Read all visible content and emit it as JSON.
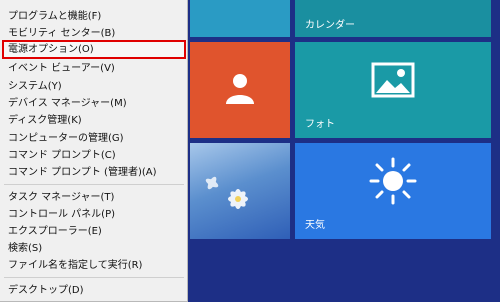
{
  "menu": {
    "group1": [
      {
        "label": "プログラムと機能(F)"
      },
      {
        "label": "モビリティ センター(B)"
      },
      {
        "label": "電源オプション(O)"
      },
      {
        "label": "イベント ビューアー(V)"
      },
      {
        "label": "システム(Y)"
      },
      {
        "label": "デバイス マネージャー(M)"
      },
      {
        "label": "ディスク管理(K)"
      },
      {
        "label": "コンピューターの管理(G)"
      },
      {
        "label": "コマンド プロンプト(C)"
      },
      {
        "label": "コマンド プロンプト (管理者)(A)"
      }
    ],
    "group2": [
      {
        "label": "タスク マネージャー(T)"
      },
      {
        "label": "コントロール パネル(P)"
      },
      {
        "label": "エクスプローラー(E)"
      },
      {
        "label": "検索(S)"
      },
      {
        "label": "ファイル名を指定して実行(R)"
      }
    ],
    "group3": [
      {
        "label": "デスクトップ(D)"
      }
    ],
    "highlighted_item": "電源オプション(O)",
    "highlight_color": "#e00000"
  },
  "tiles": {
    "calendar_label": "カレンダー",
    "photos_label": "フォト",
    "weather_label": "天気"
  },
  "colors": {
    "background": "#1d2f86",
    "people_tile": "#e0542d",
    "photos_tile": "#1a9aa6",
    "weather_tile": "#2a78e2"
  },
  "icons": [
    "person-icon",
    "photo-icon",
    "sun-icon"
  ]
}
